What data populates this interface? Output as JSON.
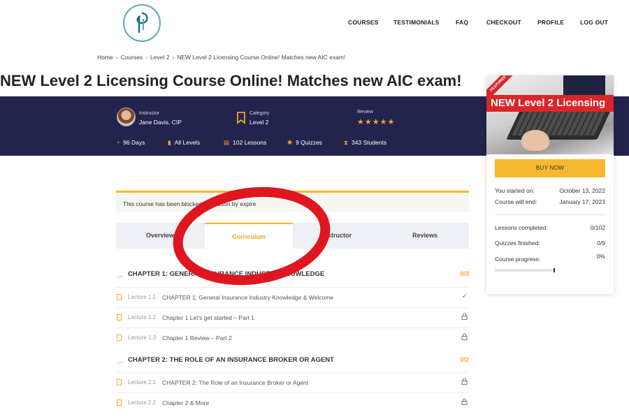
{
  "nav": {
    "items": [
      "COURSES",
      "TESTIMONIALS",
      "FAQ",
      "CHECKOUT",
      "PROFILE",
      "LOG OUT"
    ]
  },
  "breadcrumb": [
    "Home",
    "Courses",
    "Level 2",
    "NEW Level 2 Licensing Course Online! Matches new AIC exam!"
  ],
  "page_title": "NEW Level 2 Licensing Course Online! Matches new AIC exam!",
  "meta": {
    "instructor_label": "Instructor",
    "instructor_name": "Jane Davis, CIP",
    "category_label": "Category",
    "category_value": "Level 2",
    "review_label": "Review",
    "stars": "★★★★★"
  },
  "stats": {
    "duration": "96 Days",
    "levels": "All Levels",
    "lessons": "102 Lessons",
    "quizzes": "9 Quizzes",
    "students": "343 Students"
  },
  "sidebar": {
    "featured_ribbon": "FEATURED",
    "image_banner": "NEW Level 2 Licensing",
    "buy_button": "BUY NOW",
    "started_label": "You started on:",
    "started_value": "October 13, 2022",
    "end_label": "Course will end:",
    "end_value": "January 17, 2023",
    "lessons_label": "Lessons completed:",
    "lessons_value": "0/102",
    "quizzes_label": "Quizzes finished:",
    "quizzes_value": "0/9",
    "progress_label": "Course progress:",
    "progress_value": "0%"
  },
  "notice": "This course has been blocked for reason by expire",
  "tabs": [
    "Overview",
    "Curriculum",
    "Instructor",
    "Reviews"
  ],
  "curriculum": {
    "chapters": [
      {
        "title": "CHAPTER 1: GENERAL INSURANCE INDUSTRY KNOWLEDGE",
        "count": "0/3",
        "lectures": [
          {
            "num": "Lecture 1.1",
            "title": "CHAPTER 1: General Insurance Industry Knowledge & Welcome",
            "status": "✓"
          },
          {
            "num": "Lecture 1.2",
            "title": "Chapter 1 Let's get started – Part 1",
            "status": "🔒"
          },
          {
            "num": "Lecture 1.3",
            "title": "Chapter 1 Review – Part 2",
            "status": "🔒"
          }
        ]
      },
      {
        "title": "CHAPTER 2: THE ROLE OF AN INSURANCE BROKER OR AGENT",
        "count": "0/2",
        "lectures": [
          {
            "num": "Lecture 2.1",
            "title": "CHAPTER 2: The Role of an Insurance Broker or Agent",
            "status": "🔒"
          },
          {
            "num": "Lecture 2.2",
            "title": "Chapter 2 & More",
            "status": "🔒"
          }
        ]
      }
    ]
  },
  "colors": {
    "accent": "#f5b82e",
    "banner_bg": "#22244e",
    "annotation": "#e0161e"
  }
}
